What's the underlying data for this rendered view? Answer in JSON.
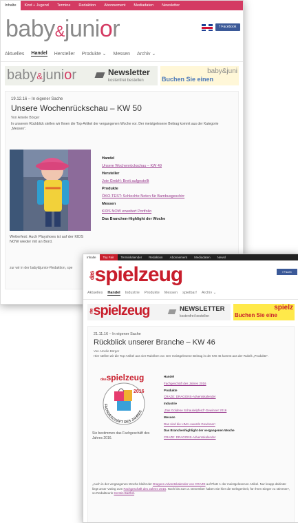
{
  "site1": {
    "topnav": [
      "Inhalte",
      "Kind + Jugend",
      "Termine",
      "Redaktion",
      "Abonnement",
      "Mediadaten",
      "Newsletter"
    ],
    "logo": {
      "a": "baby",
      "amp": "&",
      "b": "juni",
      "o": "o",
      "c": "r"
    },
    "facebook_label": "f Facebook",
    "mainnav": [
      "Aktuelles",
      "Handel",
      "Hersteller",
      "Produkte ⌄",
      "Messen",
      "Archiv ⌄"
    ],
    "banner": {
      "newsletter": "Newsletter",
      "newsletter_sub": "kostenfrei bestellen",
      "right_logo": "baby&juni",
      "right_cta": "Buchen Sie einen"
    },
    "article": {
      "date": "19.12.16 – In eigener Sache",
      "title": "Unsere Wochenrückschau – KW 50",
      "author": "Von Amelie Börger",
      "intro": "In unserem Rückblick stellen wir Ihnen die Top-Artikel der vergangenen Woche vor. Der meistgelesene Beitrag kommt aus der Kategorie „Messen“.",
      "caption": "Wetterfest: Auch Playshoes ist auf der KIDS NOW wieder mit an Bord.",
      "more": "zur wir in der baby&junior-Redaktion, spe",
      "list": [
        {
          "heading": "Handel",
          "link": "Unsere Wochenrückschau – KW 49"
        },
        {
          "heading": "Hersteller",
          "link": "Joie GmbH: Breit aufgestellt"
        },
        {
          "heading": "Produkte",
          "link": "ÖKO-TEST: Schlechte Noten für Bambusgeschirr"
        },
        {
          "heading": "Messen",
          "link": "KIDS NOW erweitert Portfolio"
        },
        {
          "heading": "Das Branchen-Highlight der Woche",
          "link": ""
        }
      ]
    }
  },
  "site2": {
    "topnav": [
      "Inhalte",
      "Toy Fair",
      "Terminkalender",
      "Redaktion",
      "Abonnement",
      "Mediadaten",
      "Newsl"
    ],
    "logo": {
      "das": "das",
      "name": "spielzeug"
    },
    "facebook_label": "f Faceb",
    "mainnav": [
      "Aktuelles",
      "Handel",
      "Industrie",
      "Produkte",
      "Messen",
      "spielbar!",
      "Archiv ⌄"
    ],
    "banner": {
      "newsletter": "NEWSLETTER",
      "newsletter_sub": "kostenfrei bestellen",
      "right_logo": "spielz",
      "right_cta": "Buchen Sie eine"
    },
    "article": {
      "date": "21.11.16 – In eigener Sache",
      "title": "Rückblick unserer Branche – KW 46",
      "author": "Von Amelie Börger",
      "intro": "Hier stellen wir die Top-Artikel aus vier Rubriken vor. Der meistgelesene Beitrag in der KW 46 kommt aus der Rubrik „Produkte“.",
      "seal": {
        "das": "das",
        "name": "spielzeug",
        "year": "2016",
        "arc": "FACHGESCHÄFT DES JAHRES"
      },
      "caption": "Sie bestimmen das Fachgeschäft des Jahres 2016.",
      "list": [
        {
          "heading": "Handel",
          "link": "Fachgeschäft des Jahres 2016"
        },
        {
          "heading": "Produkte",
          "link": "CRAZE: DRAGONS-Adventskalender"
        },
        {
          "heading": "Industrie",
          "link": "„Das Goldene Schaukelpferd“-Gewinner 2016"
        },
        {
          "heading": "Messen",
          "link": "Das sind die LIMA-Awards Gewinner!"
        },
        {
          "heading": "Das Branchenhighlight der vergangenen Woche",
          "link": "CRAZE: DRAGONS-Adventskalender"
        }
      ],
      "bottom": {
        "p1": "„Auch in der vergangenen Woche bleibt der ",
        "l1": "Dragons Adventskalender von CRAZE",
        "p2": " auf Platz 1 der meistgelesenen Artikel. Nur knapp dahinter liegt unser Voting zum ",
        "l2": "Fachgeschäft des Jahres 2016",
        "p3": ". Noch bis zum 2. Dezember haben Sie hier die Gelegenheit, für Ihren Sieger zu stimmen“, so Redakteurin ",
        "l3": "Kerstin Barthel",
        "p4": "."
      }
    }
  },
  "colors": {
    "babyjunior_pink": "#d43b63",
    "spielzeug_red": "#c81e2c",
    "link_purple": "#9a3a8e",
    "facebook_blue": "#3b5998"
  }
}
